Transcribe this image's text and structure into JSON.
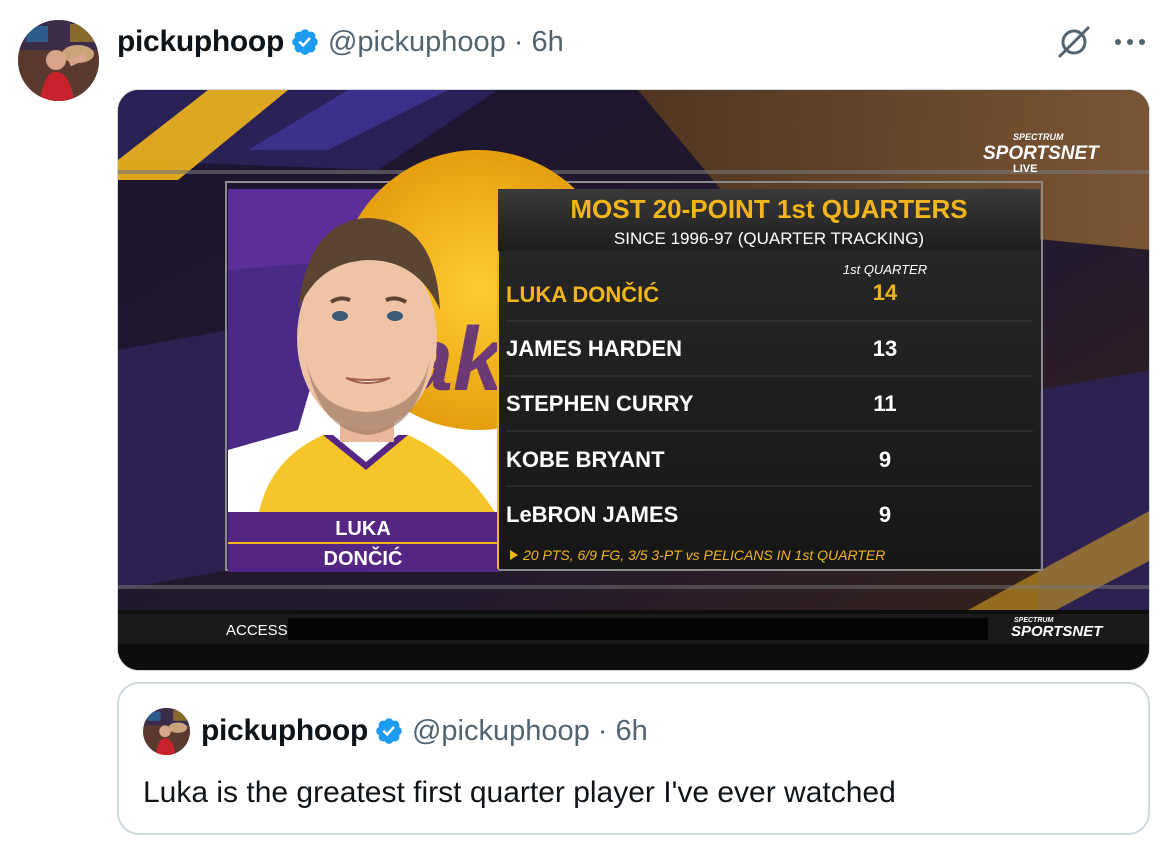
{
  "tweet": {
    "display_name": "pickuphoop",
    "handle": "@pickuphoop",
    "separator": "·",
    "time": "6h"
  },
  "icons": {
    "verified": "verified-badge-icon",
    "grok": "grok-icon",
    "more": "more-icon",
    "verified_color": "#1d9bf0"
  },
  "media": {
    "network_top": "SPECTRUM",
    "network_main": "SPORTSNET",
    "network_sub": "LIVE",
    "title": "MOST 20-POINT 1st QUARTERS",
    "subtitle": "SINCE 1996-97 (QUARTER TRACKING)",
    "column_header": "1st QUARTER",
    "player_first": "LUKA",
    "player_last": "DONČIĆ",
    "rows": [
      {
        "name": "LUKA DONČIĆ",
        "value": "14"
      },
      {
        "name": "JAMES HARDEN",
        "value": "13"
      },
      {
        "name": "STEPHEN CURRY",
        "value": "11"
      },
      {
        "name": "KOBE BRYANT",
        "value": "9"
      },
      {
        "name": "LeBRON JAMES",
        "value": "9"
      }
    ],
    "footnote": "20 PTS, 6/9 FG, 3/5 3-PT vs PELICANS IN 1st QUARTER",
    "ticker_label": "ACCESS",
    "ticker_logo_top": "SPECTRUM",
    "ticker_logo_main": "SPORTSNET",
    "gold": "#f2b61c",
    "purple": "#552583"
  },
  "quote": {
    "display_name": "pickuphoop",
    "handle": "@pickuphoop",
    "separator": "·",
    "time": "6h",
    "text": "Luka is the greatest first quarter player I've ever watched"
  }
}
